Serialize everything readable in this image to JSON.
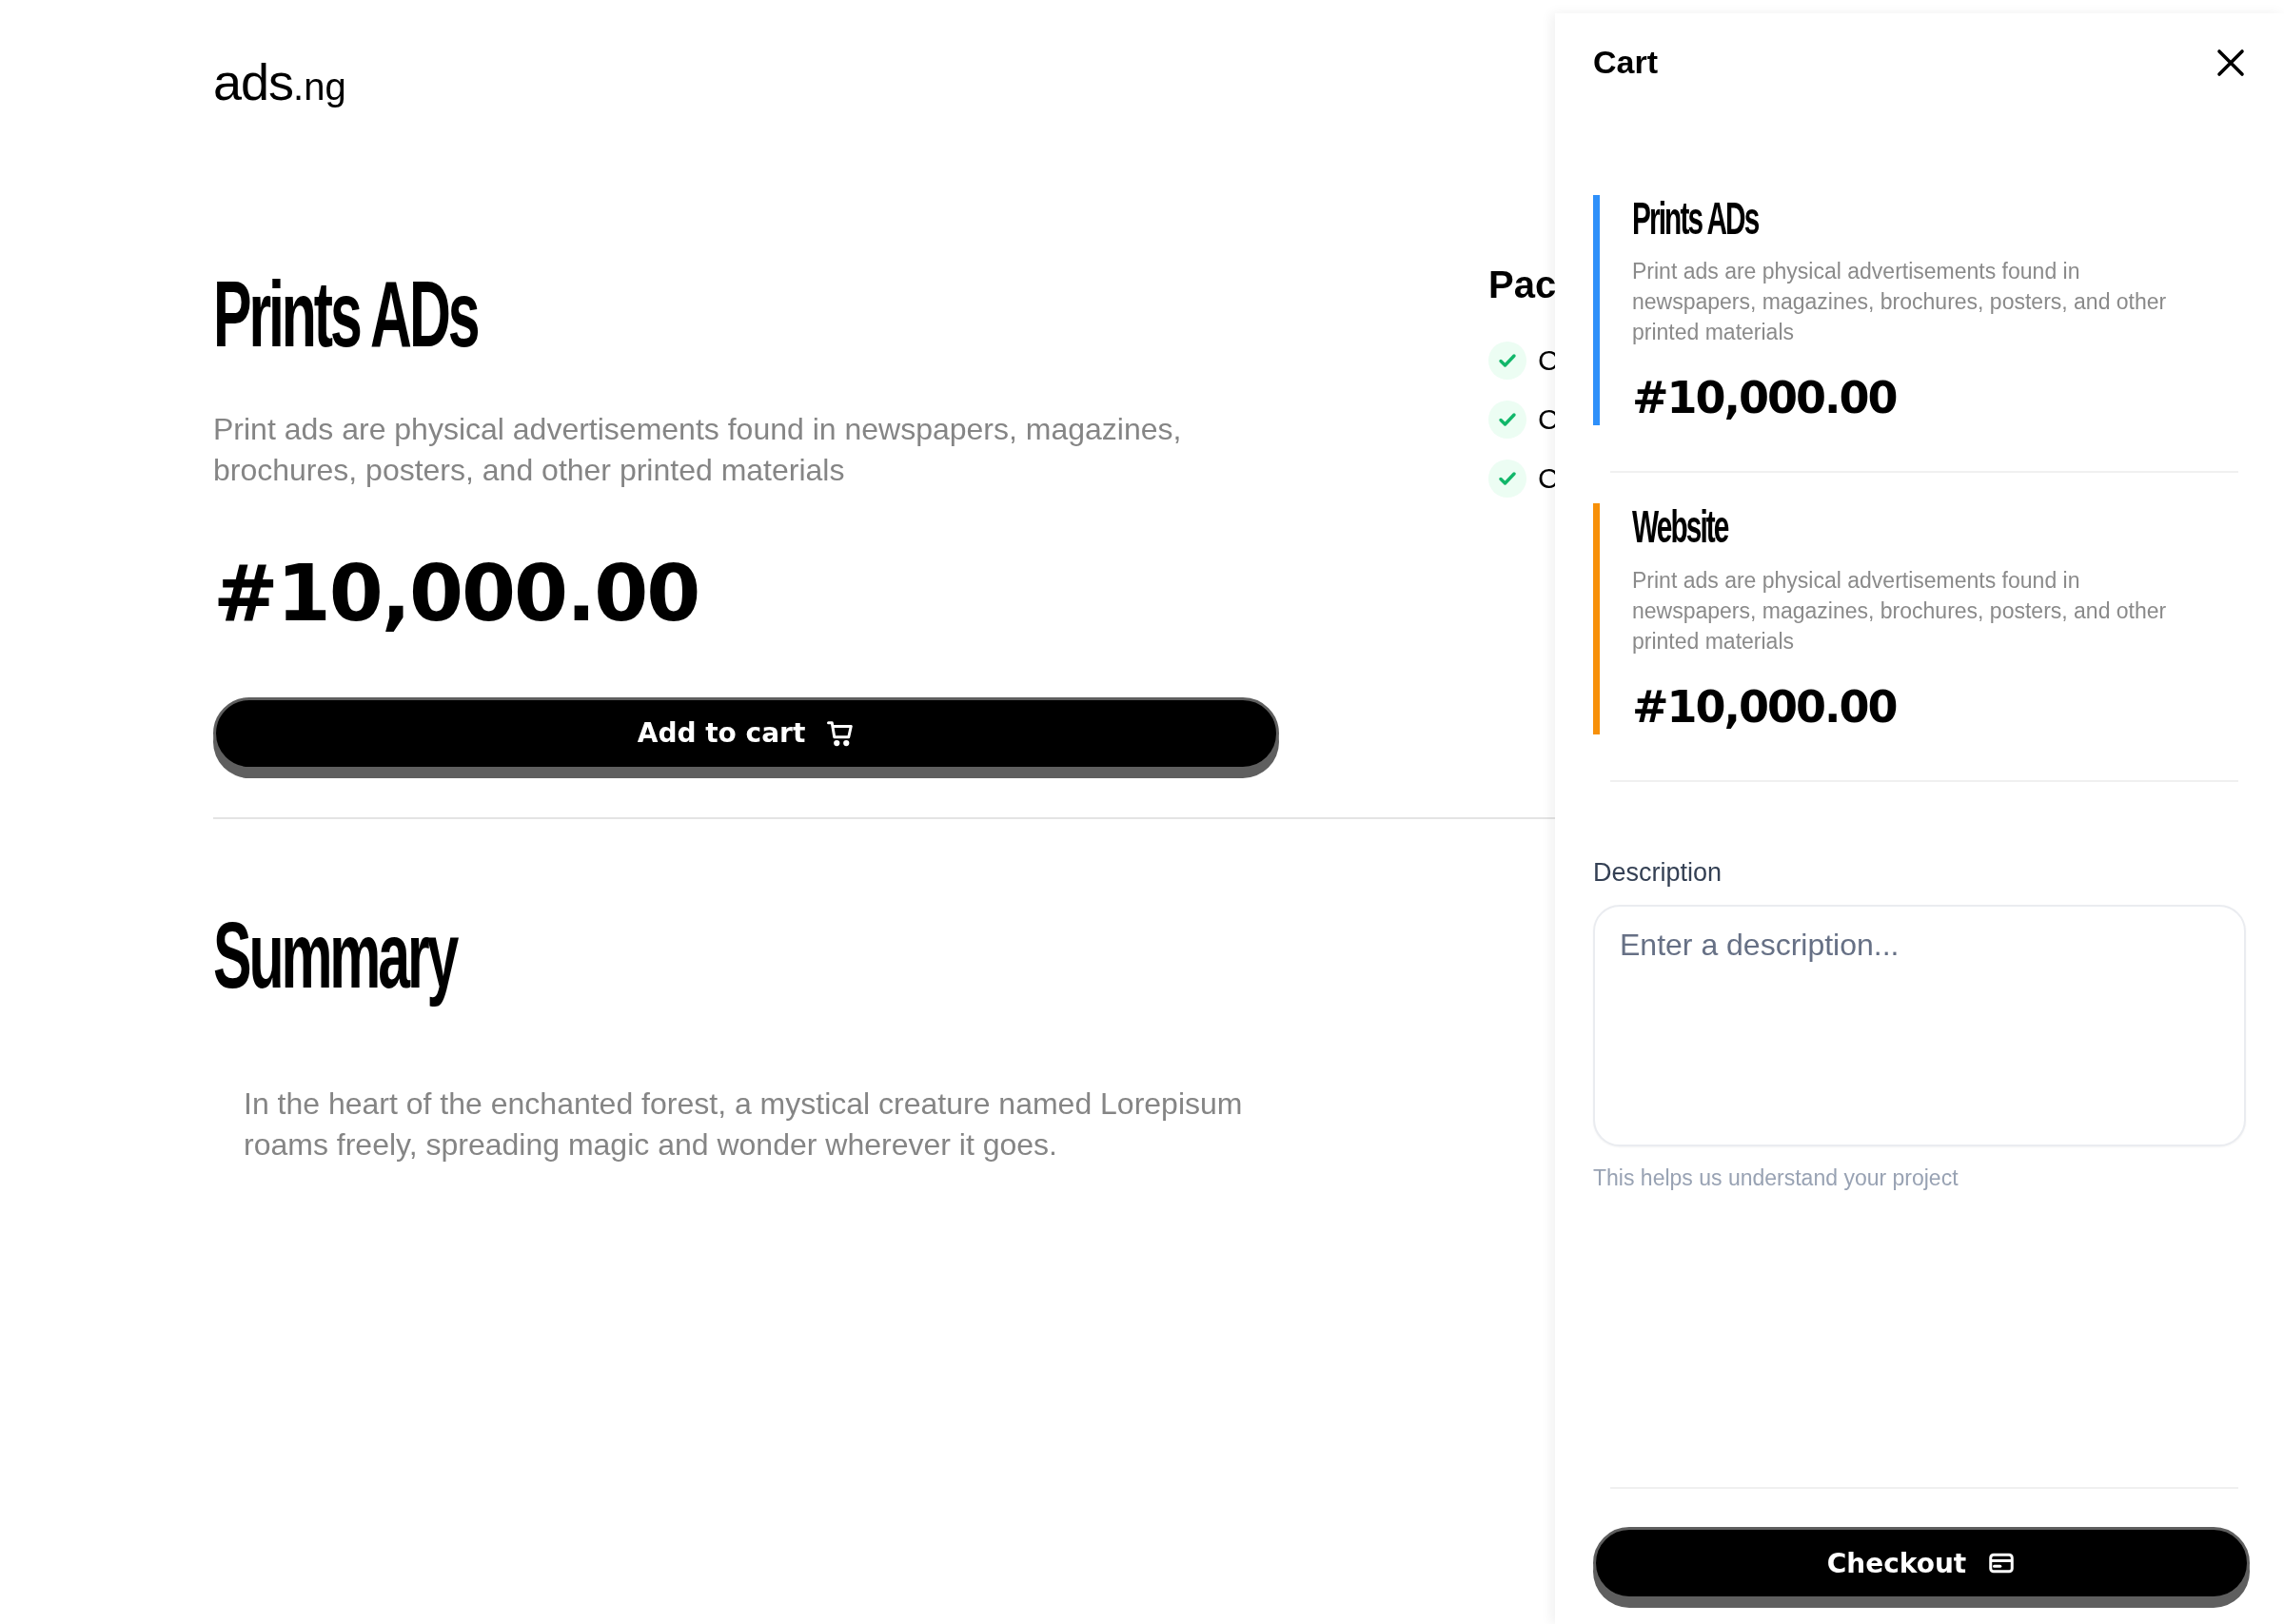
{
  "logo": {
    "name": "ads",
    "suffix": ".ng"
  },
  "product": {
    "title": "Prints ADs",
    "description": "Print ads are physical advertisements found in newspapers, magazines, brochures, posters, and other printed materials",
    "price": "#10,000.00",
    "button": "Add to cart"
  },
  "package": {
    "heading": "Pac",
    "items": [
      {
        "label": "C",
        "checked": true
      },
      {
        "label": "C",
        "checked": true
      },
      {
        "label": "C",
        "checked": true
      }
    ]
  },
  "summary": {
    "heading": "Summary",
    "text": "In the heart of the enchanted forest, a mystical creature named Lorepisum roams freely, spreading magic and wonder wherever it goes."
  },
  "cart": {
    "title": "Cart",
    "items": [
      {
        "title": "Prints ADs",
        "description": "Print ads are physical advertisements found in newspapers, magazines, brochures, posters, and other printed materials",
        "price": "#10,000.00",
        "color": "#2e90fa"
      },
      {
        "title": "Website",
        "description": "Print ads are physical advertisements found in newspapers, magazines, brochures, posters, and other printed materials",
        "price": "#10,000.00",
        "color": "#f79009"
      }
    ],
    "description_label": "Description",
    "description_placeholder": "Enter a description...",
    "hint": "This helps us understand your project",
    "button": "Checkout"
  }
}
